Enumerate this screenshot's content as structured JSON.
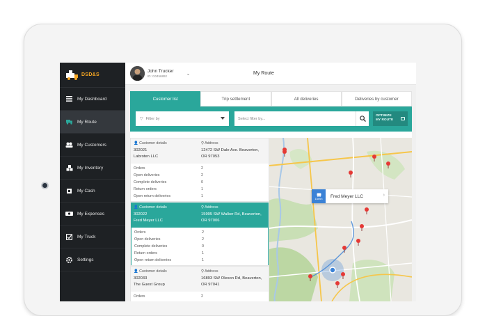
{
  "app": {
    "brand": "DSD&S",
    "page_title": "My Route"
  },
  "user": {
    "name": "John Trucker",
    "id": "ID: G0456892"
  },
  "sidebar": {
    "items": [
      {
        "label": "My Dashboard",
        "icon": "menu-icon"
      },
      {
        "label": "My Route",
        "icon": "truck-icon"
      },
      {
        "label": "My Customers",
        "icon": "users-icon"
      },
      {
        "label": "My Inventory",
        "icon": "boxes-icon"
      },
      {
        "label": "My Cash",
        "icon": "cash-icon"
      },
      {
        "label": "My Expenses",
        "icon": "expenses-icon"
      },
      {
        "label": "My Truck",
        "icon": "checklist-icon"
      },
      {
        "label": "Settings",
        "icon": "gear-icon"
      }
    ],
    "active": "My Route"
  },
  "tabs": [
    "Customer list",
    "Trip settlement",
    "All deliveries",
    "Deliveries by customer"
  ],
  "filters": {
    "filter_by": "Filter by",
    "search_placeholder": "Select filter by...",
    "optimize_line1": "OPTIMIZE",
    "optimize_line2": "MY ROUTE"
  },
  "labels": {
    "customer_details": "Customer details",
    "address": "Address",
    "orders": "Orders",
    "open_deliveries": "Open deliveries",
    "complete_deliveries": "Complete deliveries",
    "return_orders": "Return orders",
    "open_return_deliveries": "Open return deliveries"
  },
  "customers": [
    {
      "id": "302021",
      "name": "Labroten LLC",
      "address1": "12472 SW Dale Ave. Beaverton,",
      "address2": "OR 97053",
      "orders": "2",
      "open_deliveries": "2",
      "complete_deliveries": "0",
      "return_orders": "1",
      "open_return_deliveries": "1"
    },
    {
      "id": "302022",
      "name": "Fred Meyer LLC",
      "address1": "15995 SW Walker Rd, Beaverton,",
      "address2": "OR 97006",
      "orders": "2",
      "open_deliveries": "2",
      "complete_deliveries": "0",
      "return_orders": "1",
      "open_return_deliveries": "1"
    },
    {
      "id": "302033",
      "name": "The Guest Group",
      "address1": "16893 SW Oleson Rd, Beaverton,",
      "address2": "OR 97041",
      "orders": "2"
    }
  ],
  "map": {
    "callout_name": "Fred Meyer LLC",
    "callout_time": "16min"
  },
  "colors": {
    "accent": "#2aa79b",
    "sidebar": "#1e2124",
    "brand": "#f5a623",
    "pin": "#e53935",
    "route": "#3b82d6"
  }
}
